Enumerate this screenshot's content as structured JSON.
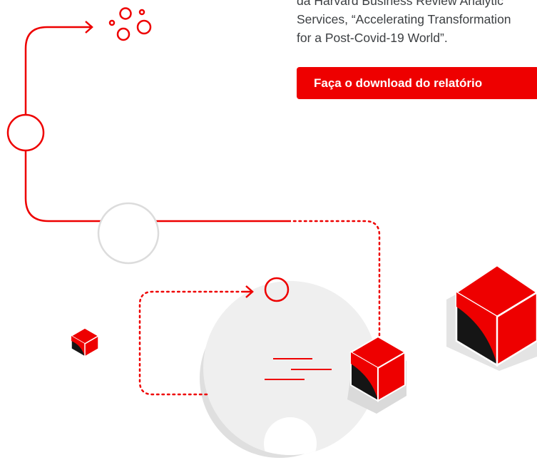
{
  "description": {
    "lines": [
      "da Harvard Business Review Analytic",
      "Services, “Accelerating Transformation",
      "for a Post-Covid-19 World”."
    ]
  },
  "cta": {
    "label": "Faça o download do relatório"
  },
  "colors": {
    "accent": "#ee0000",
    "text": "#3c3f42",
    "light_gray": "#dcdcdc",
    "dark": "#151515"
  },
  "icons": [
    "arrow-right-icon",
    "bubbles-icon",
    "cube-icon"
  ]
}
